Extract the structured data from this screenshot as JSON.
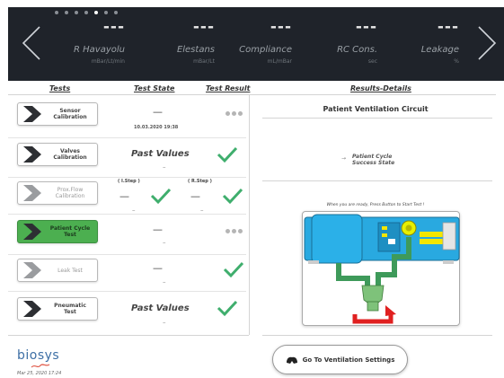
{
  "topbar": {
    "params": [
      {
        "value": "---",
        "name": "R Havayolu",
        "unit": "mBar/Lt/min"
      },
      {
        "value": "---",
        "name": "Elestans",
        "unit": "mBar/Lt"
      },
      {
        "value": "---",
        "name": "Compliance",
        "unit": "mL/mBar"
      },
      {
        "value": "---",
        "name": "RC Cons.",
        "unit": "sec"
      },
      {
        "value": "---",
        "name": "Leakage",
        "unit": "%"
      }
    ]
  },
  "headers": {
    "tests": "Tests",
    "state": "Test State",
    "result": "Test Result",
    "details": "Results-Details"
  },
  "tests": [
    {
      "label_1": "Sensor",
      "label_2": "Calibration",
      "state": "—",
      "date": "10.03.2020 19:38",
      "result": "pending"
    },
    {
      "label_1": "Valves",
      "label_2": "Calibration",
      "state": "Past Values",
      "sub": "–",
      "result": "ok"
    },
    {
      "label_1": "Prox.Flow",
      "label_2": "Calibration",
      "step_left": "( I.Step )",
      "step_right": "( R.Step )",
      "dash_left": "—",
      "dash_right": "—",
      "sub_left": "–",
      "sub_right": "–",
      "result": "ok"
    },
    {
      "label_1": "Patient Cycle",
      "label_2": "Test",
      "state": "—",
      "sub": "–",
      "result": "pending"
    },
    {
      "label_1": "Leak Test",
      "label_2": "",
      "state": "—",
      "sub": "–",
      "result": "ok"
    },
    {
      "label_1": "Pneumatic",
      "label_2": "Test",
      "state": "Past Values",
      "sub": "–",
      "result": "ok"
    }
  ],
  "panel": {
    "title": "Patient Ventilation Circuit",
    "arrow": "→",
    "cycle_line1": "Patient Cycle",
    "cycle_line2": "Success State",
    "ready_msg": "When you are ready, Press Button to Start Test !"
  },
  "vent_button": {
    "label": "Go To Ventilation Settings"
  },
  "footer": {
    "logo": "biosys",
    "date": "Mar 25, 2020 17:24"
  },
  "colors": {
    "accent_green": "#4caf50",
    "topbar_bg": "#1f232a",
    "diagram_blue": "#29a9e0",
    "tube_green": "#3e9a5a"
  }
}
